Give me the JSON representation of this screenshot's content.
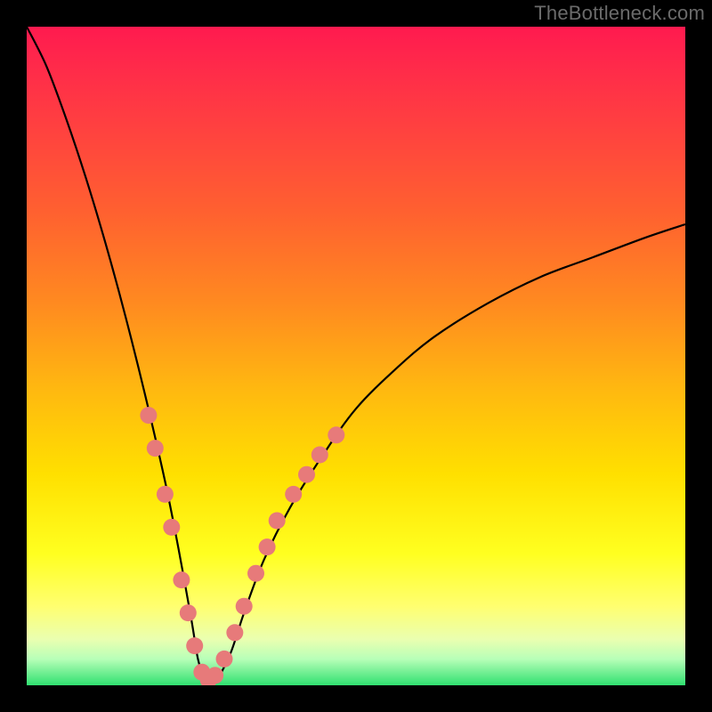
{
  "watermark": "TheBottleneck.com",
  "colors": {
    "curve_stroke": "#000000",
    "dots_fill": "#e77a7a",
    "frame": "#000000"
  },
  "chart_data": {
    "type": "line",
    "title": "",
    "xlabel": "",
    "ylabel": "",
    "xlim": [
      0,
      100
    ],
    "ylim": [
      0,
      100
    ],
    "notes": "V-shaped bottleneck curve. y ≈ 100 at x=0, drops to ~0 at x≈27, rises back toward ~70 at x=100. No tick labels shown.",
    "series": [
      {
        "name": "bottleneck-curve",
        "x": [
          0,
          3,
          6,
          9,
          12,
          15,
          18,
          21,
          23,
          25,
          26,
          27,
          28,
          29,
          31,
          33,
          36,
          40,
          45,
          50,
          56,
          62,
          70,
          78,
          86,
          94,
          100
        ],
        "y": [
          100,
          94,
          86,
          77,
          67,
          56,
          44,
          31,
          21,
          10,
          4,
          1,
          0,
          1,
          5,
          11,
          19,
          27,
          35,
          42,
          48,
          53,
          58,
          62,
          65,
          68,
          70
        ]
      }
    ],
    "markers": [
      {
        "x": 18.5,
        "y": 41
      },
      {
        "x": 19.5,
        "y": 36
      },
      {
        "x": 21.0,
        "y": 29
      },
      {
        "x": 22.0,
        "y": 24
      },
      {
        "x": 23.5,
        "y": 16
      },
      {
        "x": 24.5,
        "y": 11
      },
      {
        "x": 25.5,
        "y": 6
      },
      {
        "x": 26.6,
        "y": 2
      },
      {
        "x": 27.6,
        "y": 0.8
      },
      {
        "x": 28.6,
        "y": 1.5
      },
      {
        "x": 30.0,
        "y": 4
      },
      {
        "x": 31.6,
        "y": 8
      },
      {
        "x": 33.0,
        "y": 12
      },
      {
        "x": 34.8,
        "y": 17
      },
      {
        "x": 36.5,
        "y": 21
      },
      {
        "x": 38.0,
        "y": 25
      },
      {
        "x": 40.5,
        "y": 29
      },
      {
        "x": 42.5,
        "y": 32
      },
      {
        "x": 44.5,
        "y": 35
      },
      {
        "x": 47.0,
        "y": 38
      }
    ]
  }
}
